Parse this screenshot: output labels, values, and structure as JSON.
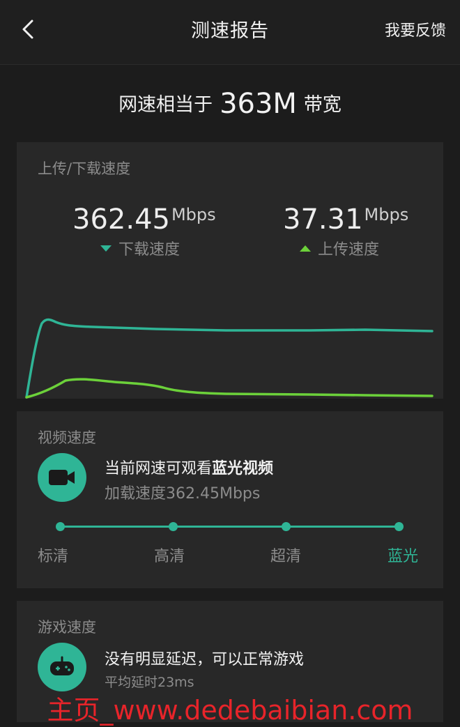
{
  "header": {
    "title": "测速报告",
    "feedback_label": "我要反馈"
  },
  "summary": {
    "prefix": "网速相当于",
    "value": "363M",
    "suffix": "带宽"
  },
  "speed_card": {
    "label": "上传/下载速度",
    "download": {
      "value": "362.45",
      "unit": "Mbps",
      "caption": "下载速度",
      "color": "#2fb596"
    },
    "upload": {
      "value": "37.31",
      "unit": "Mbps",
      "caption": "上传速度",
      "color": "#6cd13a"
    }
  },
  "video_card": {
    "label": "视频速度",
    "icon": "video-camera-icon",
    "main_prefix": "当前网速可观看",
    "main_bold": "蓝光视频",
    "sub": "加载速度362.45Mbps",
    "levels": [
      "标清",
      "高清",
      "超清",
      "蓝光"
    ],
    "active_level": "蓝光"
  },
  "game_card": {
    "label": "游戏速度",
    "icon": "gamepad-icon",
    "main": "没有明显延迟，可以正常游戏",
    "sub": "平均延时23ms"
  },
  "watermark": "主页_www.dedebaibian.com",
  "colors": {
    "accent": "#2fb596",
    "upload": "#6cd13a",
    "watermark": "#e8242a"
  }
}
